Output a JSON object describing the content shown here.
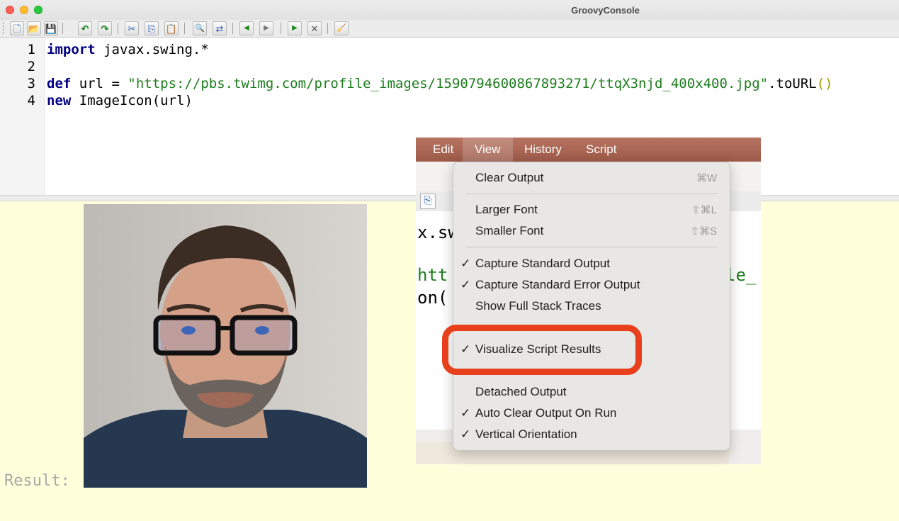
{
  "window": {
    "title": "GroovyConsole",
    "buttons": [
      "close",
      "minimize",
      "maximize"
    ]
  },
  "toolbar": {
    "icons": [
      {
        "name": "new-file-icon",
        "glyph": "🗋"
      },
      {
        "name": "open-file-icon",
        "glyph": "📂"
      },
      {
        "name": "save-file-icon",
        "glyph": "💾"
      },
      {
        "name": "undo-icon",
        "glyph": "↶"
      },
      {
        "name": "redo-icon",
        "glyph": "↷"
      },
      {
        "name": "cut-icon",
        "glyph": "✂"
      },
      {
        "name": "copy-icon",
        "glyph": "⎘"
      },
      {
        "name": "paste-icon",
        "glyph": "📋"
      },
      {
        "name": "find-icon",
        "glyph": "🔍"
      },
      {
        "name": "replace-icon",
        "glyph": "⇄"
      },
      {
        "name": "history-previous-icon",
        "glyph": "◀"
      },
      {
        "name": "history-next-icon",
        "glyph": "▶"
      },
      {
        "name": "run-script-icon",
        "glyph": "▶"
      },
      {
        "name": "interrupt-icon",
        "glyph": "✕"
      },
      {
        "name": "clear-output-icon",
        "glyph": "🧹"
      }
    ]
  },
  "editor": {
    "line_numbers": [
      "1",
      "2",
      "3",
      "4"
    ],
    "line1": {
      "kw": "import",
      "rest": " javax.swing.*"
    },
    "line3": {
      "kw": "def",
      "mid": " url = ",
      "str": "\"https://pbs.twimg.com/profile_images/1590794600867893271/ttqX3njd_400x400.jpg\"",
      "after": ".toURL",
      "parens": "()"
    },
    "line4": {
      "kw": "new",
      "rest": " ImageIcon(url)"
    }
  },
  "output": {
    "result_label": "Result:",
    "image_alt": "profile photo"
  },
  "inset": {
    "menubar": [
      "Edit",
      "View",
      "History",
      "Script"
    ],
    "active_menu": "View",
    "code_fragments": [
      "x.sw",
      "htt",
      "on(",
      "le_"
    ],
    "menu_items": [
      {
        "label": "Clear Output",
        "checked": false,
        "shortcut": "⌘W"
      },
      {
        "label": "Larger Font",
        "checked": false,
        "shortcut": "⇧⌘L"
      },
      {
        "label": "Smaller Font",
        "checked": false,
        "shortcut": "⇧⌘S"
      },
      {
        "label": "Capture Standard Output",
        "checked": true,
        "shortcut": ""
      },
      {
        "label": "Capture Standard Error Output",
        "checked": true,
        "shortcut": ""
      },
      {
        "label": "Show Full Stack Traces",
        "checked": false,
        "shortcut": ""
      },
      {
        "label": "Visualize Script Results",
        "checked": true,
        "shortcut": ""
      },
      {
        "label": "Detached Output",
        "checked": false,
        "shortcut": ""
      },
      {
        "label": "Auto Clear Output On Run",
        "checked": true,
        "shortcut": ""
      },
      {
        "label": "Vertical Orientation",
        "checked": true,
        "shortcut": ""
      }
    ],
    "check_glyph": "✓",
    "highlight_color": "#e8401c"
  }
}
